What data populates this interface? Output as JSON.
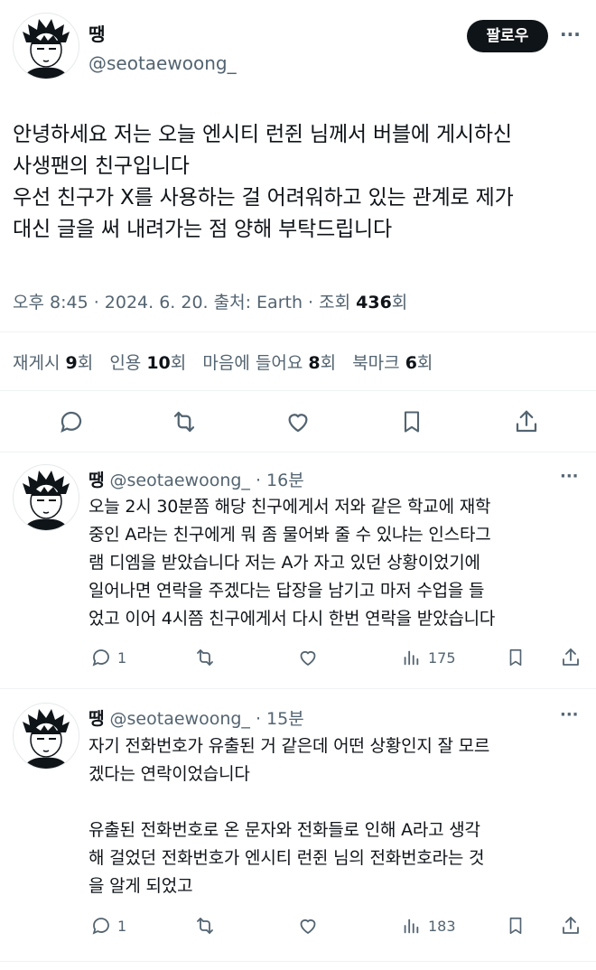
{
  "main_tweet": {
    "author_name": "땡",
    "author_handle": "@seotaewoong_",
    "follow_label": "팔로우",
    "more_label": "···",
    "text": "안녕하세요 저는 오늘 엔시티 런쥔 님께서 버블에 게시하신\n사생팬의 친구입니다\n우선 친구가 X를 사용하는 걸 어려워하고 있는 관계로 제가\n대신 글을 써 내려가는 점 양해 부탁드립니다",
    "meta_time": "오후 8:45 · 2024. 6. 20. 출처: Earth · 조회 ",
    "views_count": "436",
    "views_suffix": "회",
    "stats": {
      "repost_label": "재게시 ",
      "repost_count": "9",
      "repost_suffix": "회",
      "quote_label": "인용 ",
      "quote_count": "10",
      "quote_suffix": "회",
      "like_label": "마음에 들어요 ",
      "like_count": "8",
      "like_suffix": "회",
      "bookmark_label": "북마크 ",
      "bookmark_count": "6",
      "bookmark_suffix": "회"
    },
    "actions": [
      "reply-icon",
      "repost-icon",
      "like-icon",
      "bookmark-icon",
      "share-icon"
    ]
  },
  "replies": [
    {
      "author_name": "땡",
      "author_handle": "@seotaewoong_",
      "time": "· 16분",
      "more_label": "···",
      "text": "오늘 2시 30분쯤 해당 친구에게서 저와 같은 학교에 재학\n중인 A라는 친구에게 뭐 좀 물어봐 줄 수 있냐는 인스타그\n램 디엠을 받았습니다 저는 A가 자고 있던 상황이었기에\n일어나면 연락을 주겠다는 답장을 남기고 마저 수업을 들\n었고 이어 4시쯤 친구에게서 다시 한번 연락을 받았습니다",
      "reply_count": "1",
      "view_count": "175"
    },
    {
      "author_name": "땡",
      "author_handle": "@seotaewoong_",
      "time": "· 15분",
      "more_label": "···",
      "text": "자기 전화번호가 유출된 거 같은데 어떤 상황인지 잘 모르\n겠다는 연락이었습니다\n\n유출된 전화번호로 온 문자와 전화들로 인해 A라고 생각\n해 걸었던 전화번호가 엔시티 런쥔 님의 전화번호라는 것\n을 알게 되었고",
      "reply_count": "1",
      "view_count": "183"
    }
  ],
  "colors": {
    "text": "#0f1419",
    "muted": "#536471",
    "divider": "#eff3f4",
    "follow_bg": "#0f1419"
  }
}
